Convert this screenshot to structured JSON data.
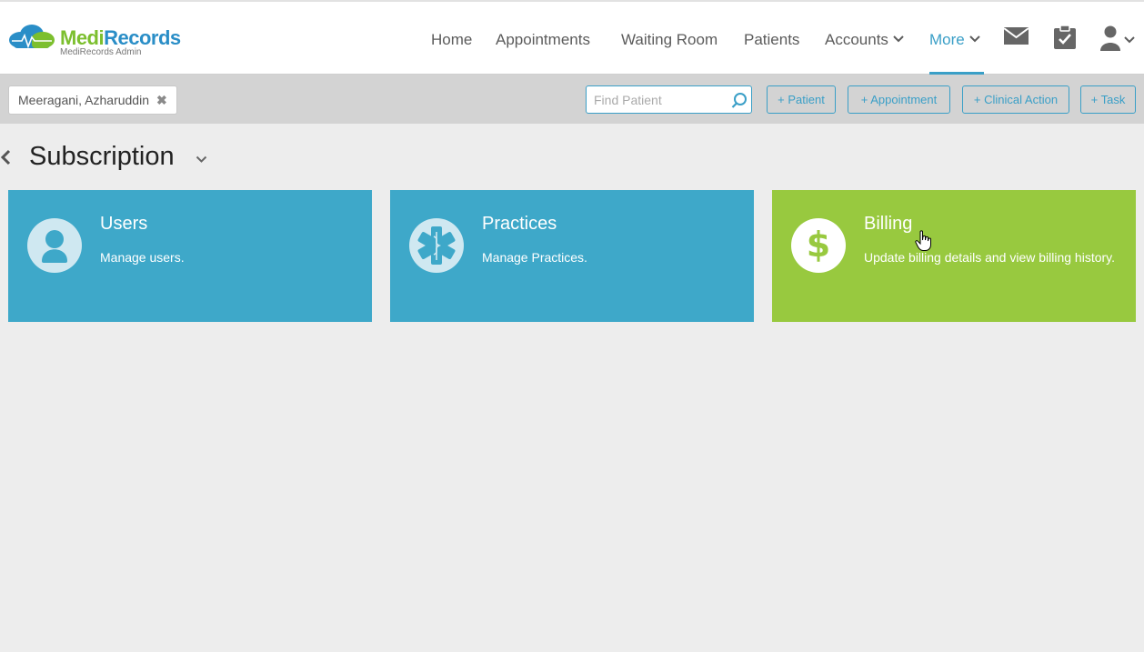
{
  "brand": {
    "name_part1": "Medi",
    "name_part2": "Records",
    "subtitle": "MediRecords Admin"
  },
  "nav": {
    "items": [
      {
        "label": "Home"
      },
      {
        "label": "Appointments"
      },
      {
        "label": "Waiting Room"
      },
      {
        "label": "Patients"
      },
      {
        "label": "Accounts",
        "has_dropdown": true
      },
      {
        "label": "More",
        "has_dropdown": true,
        "active": true
      }
    ],
    "icons": [
      "mail-icon",
      "clipboard-check-icon",
      "user-icon"
    ]
  },
  "toolbar": {
    "patient_tag": "Meeragani, Azharuddin",
    "find_patient_placeholder": "Find Patient",
    "buttons": [
      "+ Patient",
      "+ Appointment",
      "+ Clinical Action",
      "+ Task"
    ]
  },
  "page": {
    "title": "Subscription"
  },
  "cards": [
    {
      "title": "Users",
      "description": "Manage users.",
      "icon": "user-icon",
      "color": "#3ea8c9"
    },
    {
      "title": "Practices",
      "description": "Manage Practices.",
      "icon": "star-of-life-icon",
      "color": "#3ea8c9"
    },
    {
      "title": "Billing",
      "description": "Update billing details and view billing history.",
      "icon": "dollar-icon",
      "color": "#98c93f"
    }
  ],
  "colors": {
    "accent": "#3a9fc7",
    "brand_green": "#7cbf2e",
    "card_blue": "#3ea8c9",
    "card_green": "#98c93f"
  }
}
